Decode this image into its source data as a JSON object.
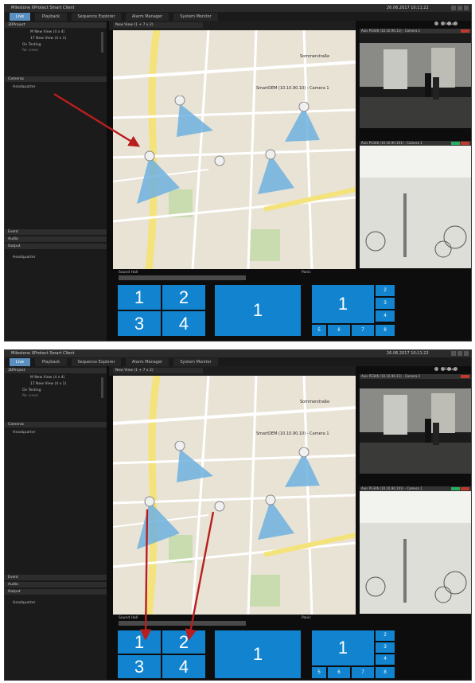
{
  "window": {
    "title": "Milestone XProtect Smart Client",
    "clock": "26.06.2017 10:11:22"
  },
  "tabs": [
    {
      "label": "Live"
    },
    {
      "label": "Playback"
    },
    {
      "label": "Sequence Explorer"
    },
    {
      "label": "Alarm Manager"
    },
    {
      "label": "System Monitor"
    }
  ],
  "setup_label": "Setup",
  "sidebar": {
    "views_header": "3DProject",
    "views": [
      "M New View (4 x 4)",
      "17 New View (4 x 1)",
      "Ov Testing",
      "No views"
    ],
    "cameras_header": "Cameras",
    "cameras_item": "Headquarter",
    "panels": [
      "Event",
      "Audio",
      "Output"
    ],
    "output_item": "Headquarter"
  },
  "view_title": "New View (1 + 7 x 2)",
  "map_label": "Sommerstraße",
  "map_camera_label": "SmartDEM (10.10.90.10) - Camera 1",
  "camera_top_label": "Axis P3346 (10.10.90.11) - Camera 1",
  "camera_bottom_label": "Axis P1346 (10.10.90.101) - Camera 1",
  "camera_colors": {
    "recording": "#c0392b",
    "live": "#27ae60"
  },
  "events": {
    "left": "Sound Hall",
    "right": "Panic"
  },
  "layouts": {
    "quad": [
      "1",
      "2",
      "3",
      "4"
    ],
    "single": "1",
    "one_plus_seven": {
      "main": "1",
      "small": [
        "2",
        "3",
        "4",
        "5",
        "6",
        "7",
        "8"
      ]
    }
  },
  "colors": {
    "tile": "#1183cf",
    "arrow": "#b81e1e",
    "active_tab": "#5a8fc0"
  }
}
